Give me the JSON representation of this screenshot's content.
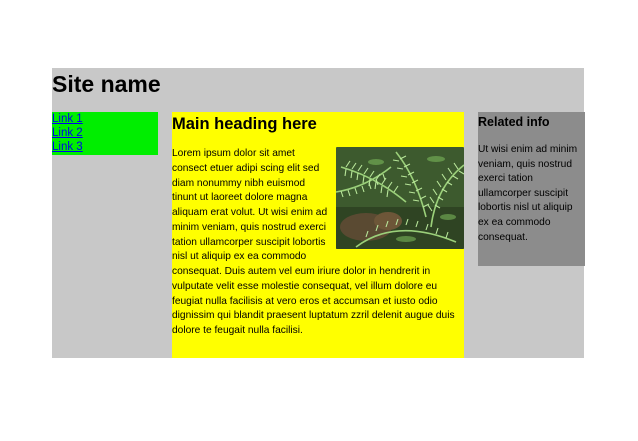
{
  "header": {
    "site_name": "Site name"
  },
  "nav": {
    "links": [
      "Link 1",
      "Link 2",
      "Link 3"
    ]
  },
  "main": {
    "heading": "Main heading here",
    "body": "Lorem ipsum dolor sit amet consect etuer adipi scing elit sed diam nonummy nibh euismod tinunt ut laoreet dolore magna aliquam erat volut. Ut wisi enim ad minim veniam, quis nostrud exerci tation ullamcorper suscipit lobortis nisl ut aliquip ex ea commodo consequat. Duis autem vel eum iriure dolor in hendrerit in vulputate velit esse molestie consequat, vel illum dolore eu feugiat nulla facilisis at vero eros et accumsan et iusto odio dignissim qui blandit praesent luptatum zzril delenit augue duis dolore te feugait nulla facilisi.",
    "image": "fern-photo"
  },
  "sidebar": {
    "heading": "Related info",
    "body": "Ut wisi enim ad minim veniam, quis nostrud exerci tation ullamcorper suscipit lobortis nisl ut aliquip ex ea commodo consequat."
  },
  "colors": {
    "page_bg": "#c8c8c8",
    "nav_bg": "#00ee00",
    "main_bg": "#ffff00",
    "sidebar_bg": "#8c8c8c",
    "link": "#0000ee"
  }
}
